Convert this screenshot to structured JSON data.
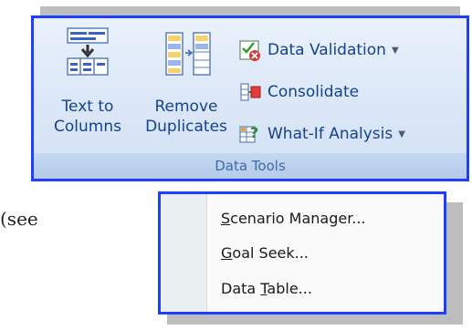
{
  "ribbon": {
    "text_to_columns_label": "Text to\nColumns",
    "remove_duplicates_label": "Remove\nDuplicates",
    "data_validation_label": "Data Validation",
    "consolidate_label": "Consolidate",
    "what_if_label": "What-If Analysis",
    "group_label": "Data Tools"
  },
  "menu": {
    "items": [
      {
        "pre": "",
        "key": "S",
        "post": "cenario Manager..."
      },
      {
        "pre": "",
        "key": "G",
        "post": "oal Seek..."
      },
      {
        "pre": "Data ",
        "key": "T",
        "post": "able..."
      }
    ]
  },
  "body": {
    "text": "(see"
  },
  "colors": {
    "accent_border": "#1f3fff",
    "ribbon_text": "#15428b",
    "group_label": "#3e6aaa"
  },
  "icons": [
    "text-to-columns-icon",
    "remove-duplicates-icon",
    "data-validation-icon",
    "consolidate-icon",
    "what-if-analysis-icon",
    "dropdown-arrow-icon"
  ]
}
